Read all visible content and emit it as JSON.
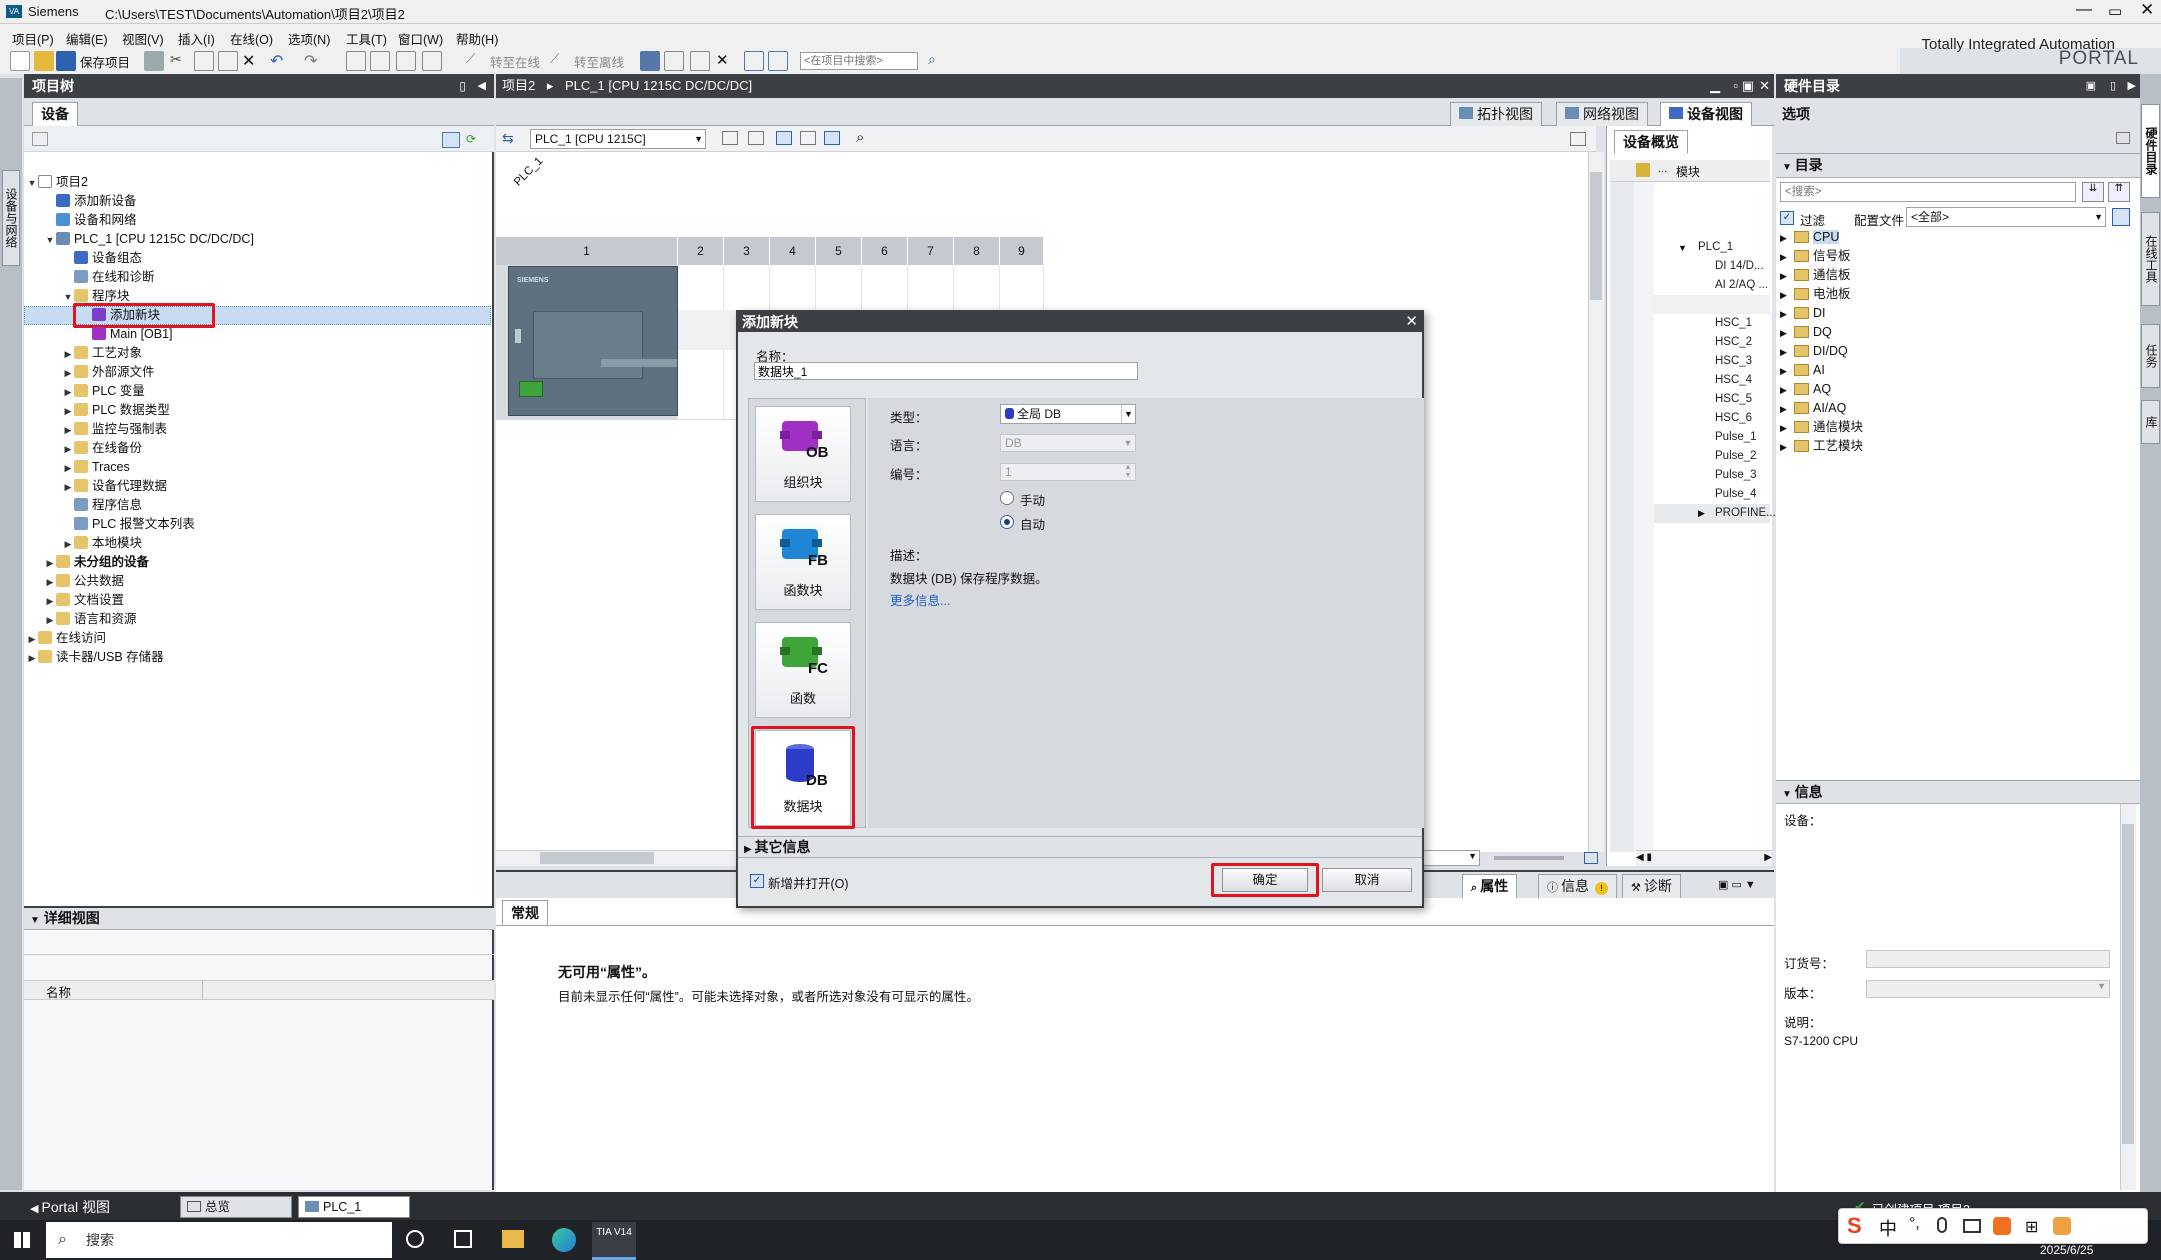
{
  "window": {
    "app": "Siemens",
    "title": "C:\\Users\\TEST\\Documents\\Automation\\项目2\\项目2",
    "brand_line1": "Totally Integrated Automation",
    "brand_line2": "PORTAL"
  },
  "menu": [
    "项目(P)",
    "编辑(E)",
    "视图(V)",
    "插入(I)",
    "在线(O)",
    "选项(N)",
    "工具(T)",
    "窗口(W)",
    "帮助(H)"
  ],
  "toolbar": {
    "save_label": "保存项目",
    "go_online": "转至在线",
    "go_offline": "转至离线",
    "search_placeholder": "<在项目中搜索>"
  },
  "project_tree": {
    "title": "项目树",
    "tab": "设备",
    "side_tab": "设备与网络",
    "items": [
      {
        "label": "项目2"
      },
      {
        "label": "添加新设备"
      },
      {
        "label": "设备和网络"
      },
      {
        "label": "PLC_1 [CPU 1215C DC/DC/DC]"
      },
      {
        "label": "设备组态"
      },
      {
        "label": "在线和诊断"
      },
      {
        "label": "程序块"
      },
      {
        "label": "添加新块"
      },
      {
        "label": "Main [OB1]"
      },
      {
        "label": "工艺对象"
      },
      {
        "label": "外部源文件"
      },
      {
        "label": "PLC 变量"
      },
      {
        "label": "PLC 数据类型"
      },
      {
        "label": "监控与强制表"
      },
      {
        "label": "在线备份"
      },
      {
        "label": "Traces"
      },
      {
        "label": "设备代理数据"
      },
      {
        "label": "程序信息"
      },
      {
        "label": "PLC 报警文本列表"
      },
      {
        "label": "本地模块"
      },
      {
        "label": "未分组的设备"
      },
      {
        "label": "公共数据"
      },
      {
        "label": "文档设置"
      },
      {
        "label": "语言和资源"
      },
      {
        "label": "在线访问"
      },
      {
        "label": "读卡器/USB 存储器"
      }
    ]
  },
  "detail_view": {
    "title": "详细视图",
    "col_name": "名称"
  },
  "editor": {
    "breadcrumb": [
      "项目2",
      "PLC_1 [CPU 1215C DC/DC/DC]"
    ],
    "view_tabs": [
      "拓扑视图",
      "网络视图",
      "设备视图"
    ],
    "device_select": "PLC_1 [CPU 1215C]",
    "rack_label": "PLC_1",
    "slots": [
      "1",
      "2",
      "3",
      "4",
      "5",
      "6",
      "7",
      "8",
      "9"
    ],
    "plc_brand": "SIEMENS"
  },
  "overview": {
    "title": "设备概览",
    "col_module": "模块",
    "rows": [
      "PLC_1",
      "DI 14/D...",
      "AI 2/AQ ...",
      "HSC_1",
      "HSC_2",
      "HSC_3",
      "HSC_4",
      "HSC_5",
      "HSC_6",
      "Pulse_1",
      "Pulse_2",
      "Pulse_3",
      "Pulse_4",
      "PROFINE..."
    ]
  },
  "inspector": {
    "tabs": [
      "属性",
      "信息",
      "诊断"
    ],
    "tab_general": "常规",
    "no_props_title": "无可用“属性”。",
    "no_props_desc": "目前未显示任何“属性”。可能未选择对象，或者所选对象没有可显示的属性。"
  },
  "catalog": {
    "title": "硬件目录",
    "options": "选项",
    "section": "目录",
    "search_placeholder": "<搜索>",
    "filter_label": "过滤",
    "profile_label": "配置文件",
    "profile_value": "<全部>",
    "items": [
      "CPU",
      "信号板",
      "通信板",
      "电池板",
      "DI",
      "DQ",
      "DI/DQ",
      "AI",
      "AQ",
      "AI/AQ",
      "通信模块",
      "工艺模块"
    ],
    "side_tabs": [
      "硬件目录",
      "在线工具",
      "任务",
      "库"
    ]
  },
  "info_panel": {
    "title": "信息",
    "device_label": "设备：",
    "order_label": "订货号：",
    "version_label": "版本：",
    "desc_label": "说明：",
    "desc_value": "S7-1200 CPU"
  },
  "dialog": {
    "title": "添加新块",
    "name_label": "名称：",
    "name_value": "数据块_1",
    "blocks": [
      {
        "tag": "OB",
        "label": "组织块",
        "color": "#a02fc4"
      },
      {
        "tag": "FB",
        "label": "函数块",
        "color": "#1f86d6"
      },
      {
        "tag": "FC",
        "label": "函数",
        "color": "#3ea539"
      },
      {
        "tag": "DB",
        "label": "数据块",
        "color": "#2d3cc8"
      }
    ],
    "type_label": "类型：",
    "type_value": "全局 DB",
    "lang_label": "语言：",
    "lang_value": "DB",
    "number_label": "编号：",
    "number_value": "1",
    "manual_label": "手动",
    "auto_label": "自动",
    "desc_label": "描述：",
    "desc_text": "数据块 (DB) 保存程序数据。",
    "more_info": "更多信息...",
    "other_info": "其它信息",
    "add_open_label": "新增并打开(O)",
    "ok_label": "确定",
    "cancel_label": "取消"
  },
  "portal_bar": {
    "portal_view": "Portal 视图",
    "overview_tab": "总览",
    "plc_tab": "PLC_1",
    "status": "已创建项目 项目2。"
  },
  "taskbar": {
    "search_placeholder": "搜索",
    "tia_label": "TIA V14",
    "ime": "中",
    "date": "2025/6/25"
  }
}
